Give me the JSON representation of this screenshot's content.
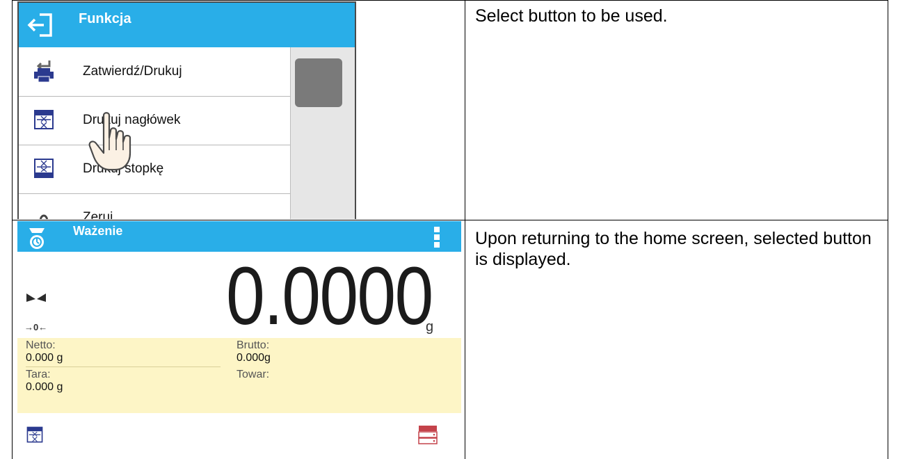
{
  "row1": {
    "description": "Select button to be used.",
    "screen": {
      "header_title": "Funkcja",
      "back_icon": "back-arrow-icon",
      "items": [
        {
          "label": "Zatwierdź/Drukuj",
          "icon": "printer-icon"
        },
        {
          "label": "Drukuj nagłówek",
          "icon": "print-header-icon"
        },
        {
          "label": "Drukuj stopkę",
          "icon": "print-footer-icon"
        },
        {
          "label": "Zeruj",
          "icon": "zero-icon"
        }
      ],
      "pointer_icon": "hand-pointer-icon"
    }
  },
  "row2": {
    "description": "Upon returning to the home screen, selected button is displayed.",
    "screen": {
      "header_title": "Ważenie",
      "mode_icon": "weighing-mode-icon",
      "menu_icon": "vertical-dots-icon",
      "weight": "0.0000",
      "unit": "g",
      "zero_indicator": "→0←",
      "stability_icon": "stability-icon",
      "netto_label": "Netto:",
      "netto_value": "0.000 g",
      "brutto_label": "Brutto:",
      "brutto_value": "0.000g",
      "tara_label": "Tara:",
      "tara_value": "0.000 g",
      "towar_label": "Towar:",
      "bottom_left_icon": "print-header-icon",
      "bottom_right_icon": "database-icon"
    }
  },
  "colors": {
    "header_blue": "#29aee8",
    "info_panel": "#fdf5c6",
    "icon_navy": "#2b3a8f"
  }
}
